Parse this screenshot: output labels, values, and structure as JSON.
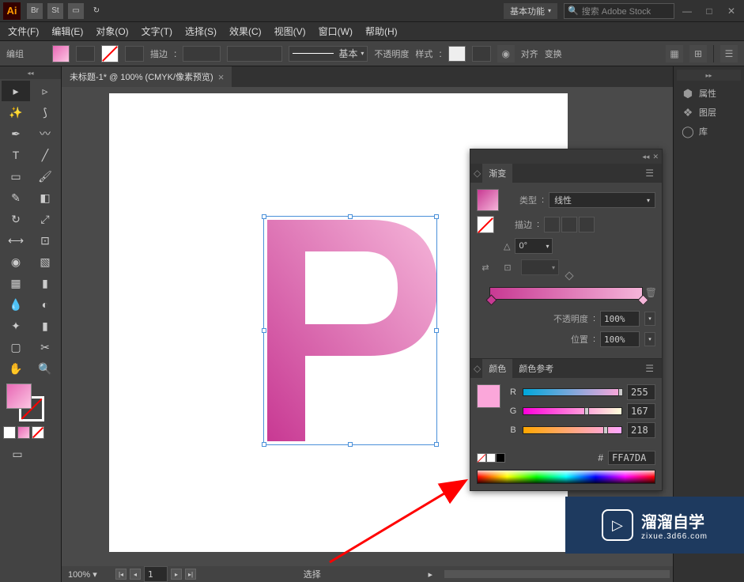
{
  "titlebar": {
    "workspace": "基本功能",
    "search_placeholder": "搜索 Adobe Stock"
  },
  "menus": [
    "文件(F)",
    "编辑(E)",
    "对象(O)",
    "文字(T)",
    "选择(S)",
    "效果(C)",
    "视图(V)",
    "窗口(W)",
    "帮助(H)"
  ],
  "controlbar": {
    "label": "编组",
    "stroke_label": "描边",
    "brush_label": "基本",
    "opacity_label": "不透明度",
    "style_label": "样式",
    "align_label": "对齐",
    "transform_label": "变换"
  },
  "document": {
    "tab_title": "未标题-1* @ 100% (CMYK/像素预览)",
    "zoom": "100%",
    "status_label": "选择"
  },
  "right_panels": {
    "properties": "属性",
    "layers": "图层",
    "libraries": "库"
  },
  "gradient_panel": {
    "tab": "渐变",
    "type_label": "类型",
    "type_value": "线性",
    "stroke_label": "描边",
    "angle_value": "0°",
    "opacity_label": "不透明度",
    "opacity_value": "100%",
    "location_label": "位置",
    "location_value": "100%"
  },
  "color_panel": {
    "tab_color": "颜色",
    "tab_guide": "颜色参考",
    "r_label": "R",
    "r_value": "255",
    "g_label": "G",
    "g_value": "167",
    "b_label": "B",
    "b_value": "218",
    "hex_prefix": "#",
    "hex_value": "FFA7DA"
  },
  "watermark": {
    "title": "溜溜自学",
    "sub": "zixue.3d66.com"
  }
}
